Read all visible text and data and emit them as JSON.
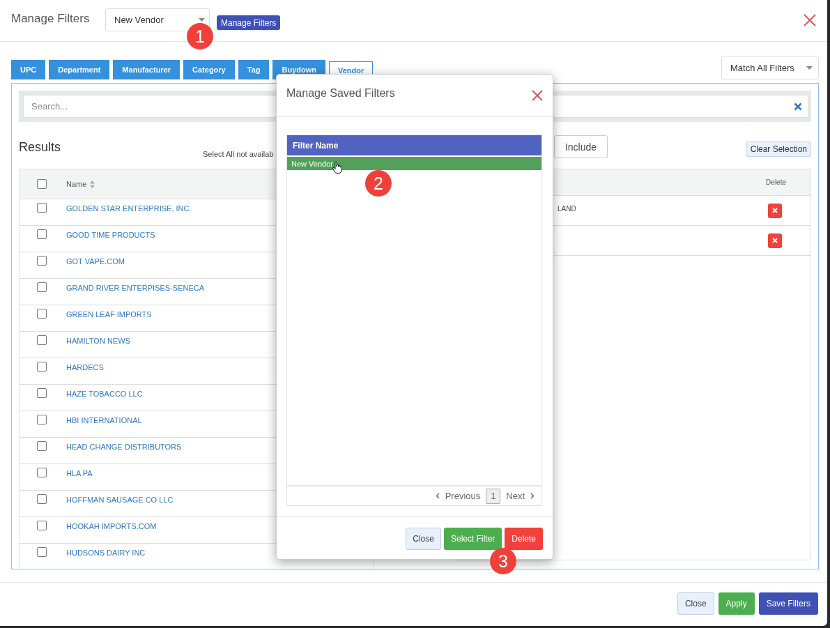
{
  "window": {
    "title": "Manage Filters"
  },
  "saved_filter_select": {
    "value": "New Vendor"
  },
  "manage_filters_button": "Manage Filters",
  "tabs": [
    {
      "label": "UPC",
      "selected": false
    },
    {
      "label": "Department",
      "selected": false
    },
    {
      "label": "Manufacturer",
      "selected": false
    },
    {
      "label": "Category",
      "selected": false
    },
    {
      "label": "Tag",
      "selected": false
    },
    {
      "label": "Buydown",
      "selected": false
    },
    {
      "label": "Vendor",
      "selected": true
    }
  ],
  "match_select": {
    "value": "Match All Filters"
  },
  "search": {
    "placeholder": "Search..."
  },
  "results": {
    "title": "Results",
    "note": "Select All not availab",
    "header_checked": false,
    "columns": [
      "Name"
    ],
    "rows": [
      {
        "name": "GOLDEN STAR ENTERPRISE, INC.",
        "checked": false
      },
      {
        "name": "GOOD TIME PRODUCTS",
        "checked": false
      },
      {
        "name": "GOT VAPE.COM",
        "checked": false
      },
      {
        "name": "GRAND RIVER ENTERPISES-SENECA",
        "checked": false
      },
      {
        "name": "GREEN LEAF IMPORTS",
        "checked": false
      },
      {
        "name": "HAMILTON NEWS",
        "checked": false
      },
      {
        "name": "HARDECS",
        "checked": false
      },
      {
        "name": "HAZE TOBACCO LLC",
        "checked": false
      },
      {
        "name": "HBI INTERNATIONAL",
        "checked": false
      },
      {
        "name": "HEAD CHANGE DISTRIBUTORS",
        "checked": false
      },
      {
        "name": "HLA PA",
        "checked": false
      },
      {
        "name": "HOFFMAN SAUSAGE CO LLC",
        "checked": false
      },
      {
        "name": "HOOKAH IMPORTS.COM",
        "checked": false
      },
      {
        "name": "HUDSONS DAIRY INC",
        "checked": false
      }
    ]
  },
  "selection": {
    "include_button": "Include",
    "clear_button": "Clear Selection",
    "columns": [
      "Delete"
    ],
    "rows": [
      {
        "column_1": "LAND"
      },
      {}
    ]
  },
  "dialog": {
    "title": "Manage Saved Filters",
    "columns": [
      "Filter Name"
    ],
    "rows": [
      {
        "name": "New Vendor",
        "selected": true
      }
    ],
    "pagination": {
      "previous": "Previous",
      "page": "1",
      "next": "Next"
    },
    "buttons": [
      {
        "label": "Close",
        "kind": "default"
      },
      {
        "label": "Select Filter",
        "kind": "success"
      },
      {
        "label": "Delete",
        "kind": "danger"
      }
    ]
  },
  "footer_buttons": [
    {
      "label": "Close",
      "kind": "default"
    },
    {
      "label": "Apply",
      "kind": "success"
    },
    {
      "label": "Save Filters",
      "kind": "primary"
    }
  ],
  "callouts": [
    "1",
    "2",
    "3"
  ]
}
